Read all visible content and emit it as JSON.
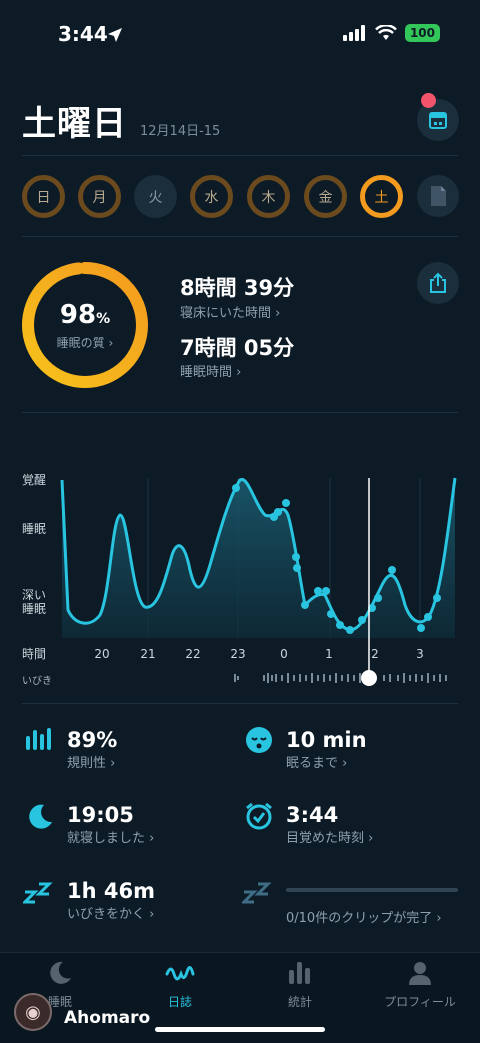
{
  "status_bar": {
    "time": "3:44",
    "battery": "100"
  },
  "header": {
    "title": "土曜日",
    "date_range": "12月14日-15"
  },
  "week": {
    "days": [
      {
        "label": "日",
        "state": "done"
      },
      {
        "label": "月",
        "state": "done"
      },
      {
        "label": "火",
        "state": "empty"
      },
      {
        "label": "水",
        "state": "done"
      },
      {
        "label": "木",
        "state": "done"
      },
      {
        "label": "金",
        "state": "done"
      },
      {
        "label": "土",
        "state": "active"
      }
    ]
  },
  "summary": {
    "quality_value": "98",
    "quality_unit": "%",
    "quality_fraction": 0.98,
    "quality_label": "睡眠の質",
    "time_in_bed": "8時間 39分",
    "time_in_bed_label": "寝床にいた時間",
    "sleep_time": "7時間 05分",
    "sleep_time_label": "睡眠時間"
  },
  "graph": {
    "y_labels": {
      "awake": "覚醒",
      "sleep": "睡眠",
      "deep_1": "深い",
      "deep_2": "睡眠"
    },
    "time_label": "時間",
    "snore_label": "いびき",
    "hours": [
      "20",
      "21",
      "22",
      "23",
      "0",
      "1",
      "2",
      "3"
    ]
  },
  "metrics": {
    "regularity": {
      "value": "89%",
      "label": "規則性"
    },
    "fall_asleep": {
      "value": "10 min",
      "label": "眠るまで"
    },
    "bedtime": {
      "value": "19:05",
      "label": "就寝しました"
    },
    "wake": {
      "value": "3:44",
      "label": "目覚めた時刻"
    },
    "snoring": {
      "value": "1h 46m",
      "label": "いびきをかく"
    },
    "clips": {
      "label": "0/10件のクリップが完了"
    }
  },
  "tabs": [
    {
      "label": "睡眠"
    },
    {
      "label": "日誌"
    },
    {
      "label": "統計"
    },
    {
      "label": "プロフィール"
    }
  ],
  "watermark": {
    "text": "Ahomaro"
  },
  "colors": {
    "accent": "#29c4e0",
    "orange": "#f39b1f",
    "background": "#0c1b26"
  }
}
